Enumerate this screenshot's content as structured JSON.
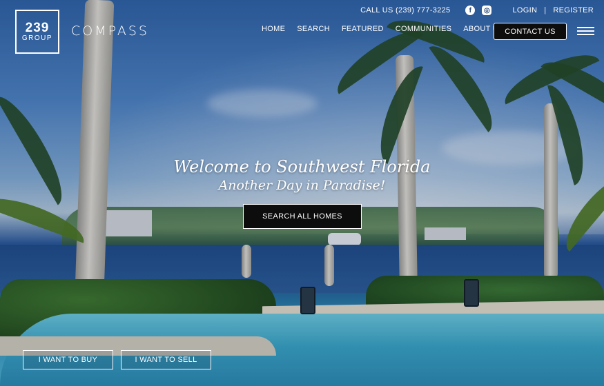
{
  "header": {
    "phone": "CALL US (239) 777-3225",
    "social": [
      {
        "icon": "facebook-icon",
        "glyph": "f"
      },
      {
        "icon": "instagram-icon",
        "glyph": "◎"
      }
    ],
    "login_label": "LOGIN",
    "separator": "|",
    "register_label": "REGISTER",
    "logo": {
      "number": "239",
      "word": "GROUP"
    },
    "brand": "COMPASS",
    "nav": [
      "HOME",
      "SEARCH",
      "FEATURED",
      "COMMUNITIES",
      "ABOUT US"
    ],
    "contact_label": "CONTACT US"
  },
  "hero": {
    "headline": "Welcome to Southwest Florida",
    "subline": "Another Day in Paradise!",
    "search_label": "SEARCH ALL HOMES",
    "buy_label": "I WANT TO BUY",
    "sell_label": "I WANT TO SELL"
  }
}
